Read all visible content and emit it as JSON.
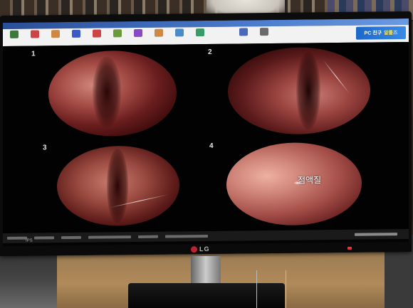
{
  "app": {
    "title": "",
    "toolbar": [
      {
        "icon": "open-icon",
        "color": "#3a7a3a",
        "label": ""
      },
      {
        "icon": "save-icon",
        "color": "#c44",
        "label": ""
      },
      {
        "icon": "print-icon",
        "color": "#c84",
        "label": ""
      },
      {
        "icon": "capture-icon",
        "color": "#3a5ac8",
        "label": ""
      },
      {
        "icon": "video-icon",
        "color": "#c44",
        "label": ""
      },
      {
        "icon": "settings-icon",
        "color": "#6a9a3a",
        "label": ""
      },
      {
        "icon": "patient-icon",
        "color": "#8a4ac8",
        "label": ""
      },
      {
        "icon": "compare-icon",
        "color": "#c84",
        "label": ""
      },
      {
        "icon": "report-icon",
        "color": "#4a8ac8",
        "label": ""
      },
      {
        "icon": "export-icon",
        "color": "#3a9a6a",
        "label": ""
      },
      {
        "icon": "zoom-icon",
        "color": "#4a6ab8",
        "label": ""
      },
      {
        "icon": "help-icon",
        "color": "#6a6a6a",
        "label": ""
      }
    ],
    "banner": {
      "text": "PC 친구",
      "accent": "알툴즈"
    }
  },
  "panes": [
    {
      "number": "1"
    },
    {
      "number": "2"
    },
    {
      "number": "3"
    },
    {
      "number": "4",
      "annotation": "점액질"
    }
  ],
  "monitor": {
    "brand": "LG",
    "model_badge": "IPS"
  }
}
